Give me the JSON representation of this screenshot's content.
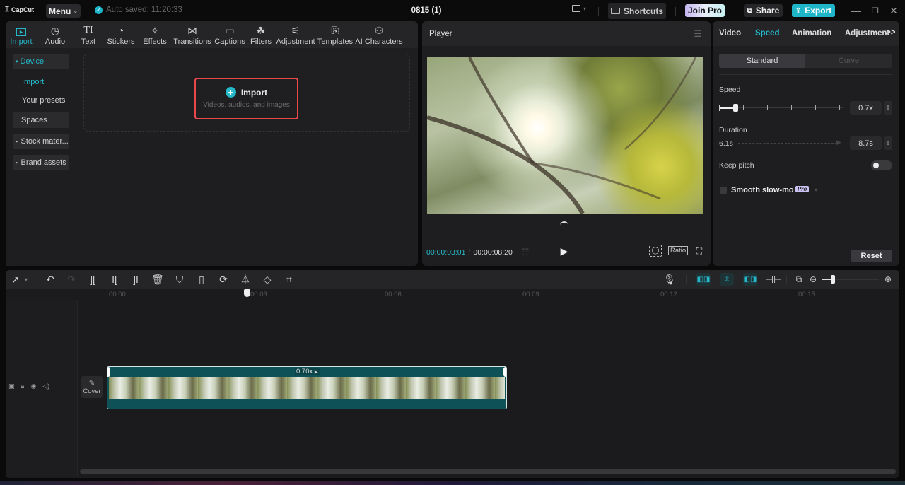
{
  "titlebar": {
    "app_name": "CapCut",
    "menu_label": "Menu",
    "autosave_text": "Auto saved: 11:20:33",
    "project_title": "0815 (1)",
    "shortcuts_label": "Shortcuts",
    "join_pro_label": "Join Pro",
    "share_label": "Share",
    "export_label": "Export"
  },
  "media_tabs": [
    {
      "label": "Import",
      "icon": "import-icon",
      "active": true
    },
    {
      "label": "Audio",
      "icon": "audio-icon"
    },
    {
      "label": "Text",
      "icon": "text-icon"
    },
    {
      "label": "Stickers",
      "icon": "stickers-icon"
    },
    {
      "label": "Effects",
      "icon": "effects-icon"
    },
    {
      "label": "Transitions",
      "icon": "transitions-icon"
    },
    {
      "label": "Captions",
      "icon": "captions-icon"
    },
    {
      "label": "Filters",
      "icon": "filters-icon"
    },
    {
      "label": "Adjustment",
      "icon": "adjustment-icon"
    },
    {
      "label": "Templates",
      "icon": "templates-icon"
    },
    {
      "label": "AI Characters",
      "icon": "ai-characters-icon"
    }
  ],
  "sidebar": {
    "device": "Device",
    "import": "Import",
    "your_presets": "Your presets",
    "spaces": "Spaces",
    "stock": "Stock mater...",
    "brand": "Brand assets"
  },
  "import_area": {
    "title": "Import",
    "subtitle": "Videos, audios, and images"
  },
  "player": {
    "title": "Player",
    "current_time": "00:00:03:01",
    "total_time": "00:00:08:20",
    "ratio_label": "Ratio"
  },
  "properties": {
    "tabs": [
      "Video",
      "Speed",
      "Animation",
      "Adjustment"
    ],
    "active_tab": "Speed",
    "more": ">>",
    "mode_standard": "Standard",
    "mode_curve": "Curve",
    "speed_label": "Speed",
    "speed_value": "0.7x",
    "speed_slider_fraction": 0.07,
    "duration_label": "Duration",
    "duration_original": "6.1s",
    "duration_value": "8.7s",
    "keep_pitch_label": "Keep pitch",
    "keep_pitch_on": false,
    "smooth_label": "Smooth slow-mo",
    "pro_badge": "Pro",
    "reset_label": "Reset"
  },
  "timeline": {
    "ruler": [
      "00:00",
      "00:03",
      "00:06",
      "00:09",
      "00:12",
      "00:15"
    ],
    "clip_speed": "0.70x",
    "cover_label": "Cover",
    "zoom_fraction": 0.18
  },
  "colors": {
    "accent": "#24b8c9",
    "clip": "#0e5257",
    "highlight": "#e8484a"
  }
}
